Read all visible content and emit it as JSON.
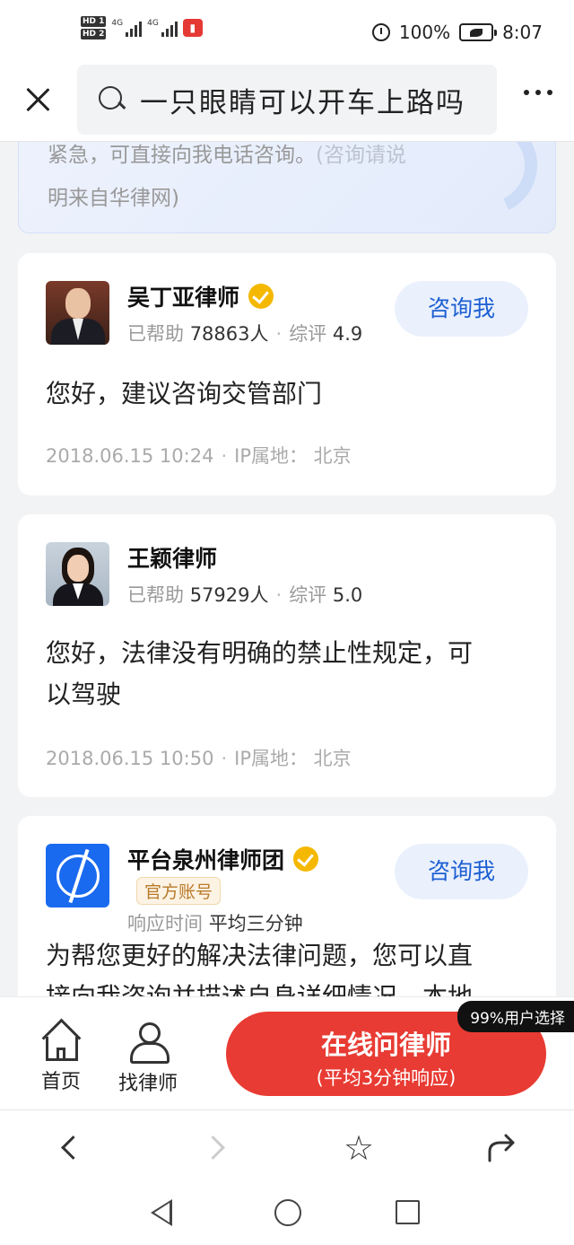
{
  "status_bar": {
    "sim1": "HD 1",
    "sim2": "HD 2",
    "network1": "4G",
    "network2": "4G",
    "battery": "100%",
    "time": "8:07"
  },
  "header": {
    "search_query": "一只眼睛可以开车上路吗"
  },
  "top_card": {
    "text_main": "紧急，可直接向我电话咨询。",
    "text_muted": "(咨询请说",
    "text_line2": "明来自华律网)"
  },
  "answers": [
    {
      "name": "吴丁亚律师",
      "verified": true,
      "helped_label": "已帮助",
      "helped_count": "78863人",
      "rating_label": "综评",
      "rating": "4.9",
      "consult_label": "咨询我",
      "answer": "您好，建议咨询交管部门",
      "date": "2018.06.15 10:24",
      "ip_label": "IP属地：",
      "ip": "北京"
    },
    {
      "name": "王颖律师",
      "verified": false,
      "helped_label": "已帮助",
      "helped_count": "57929人",
      "rating_label": "综评",
      "rating": "5.0",
      "answer_line1": "您好，法律没有明确的禁止性规定，可",
      "answer_line2": "以驾驶",
      "date": "2018.06.15 10:50",
      "ip_label": "IP属地：",
      "ip": "北京"
    },
    {
      "name": "平台泉州律师团",
      "verified": true,
      "official_badge": "官方账号",
      "response_label": "响应时间",
      "response_value": "平均三分钟",
      "consult_label": "咨询我",
      "answer_line1": "为帮您更好的解决法律问题，您可以直",
      "answer_line2": "接向我咨询并描述自身详细情况，本地"
    }
  ],
  "action_bar": {
    "home_label": "首页",
    "find_lawyer_label": "找律师",
    "cta_main": "在线问律师",
    "cta_sub": "(平均3分钟响应)",
    "badge": "99%用户选择"
  },
  "colors": {
    "accent_blue": "#1d5fd2",
    "cta_red": "#e83b33",
    "verify_gold": "#f5b800"
  }
}
